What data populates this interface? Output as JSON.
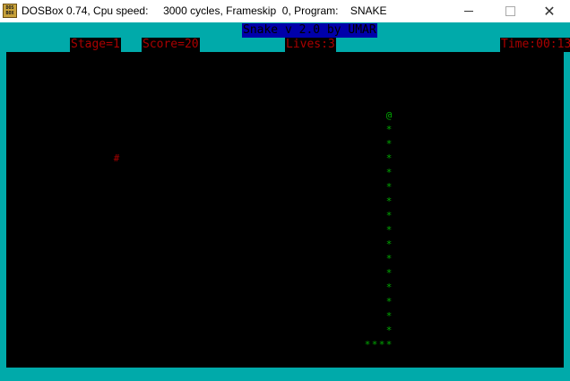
{
  "window": {
    "icon_text": "DOS BOX",
    "title": "DOSBox 0.74, Cpu speed:     3000 cycles, Frameskip  0, Program:    SNAKE",
    "minimize_label": "",
    "maximize_label": "",
    "close_label": "✕"
  },
  "game": {
    "title": "Snake v 2.0 by UMAR",
    "stage": "Stage=1",
    "score": "Score=20",
    "lives": "Lives:3",
    "time": "Time:00:13",
    "head_char": "@",
    "body_char": "*",
    "food_char": "#",
    "colors": {
      "frame": "#00aaaa",
      "board": "#000000",
      "hud_text": "#aa0000",
      "snake": "#00aa00",
      "food": "#aa0000",
      "title_bg": "#0000aa"
    }
  }
}
